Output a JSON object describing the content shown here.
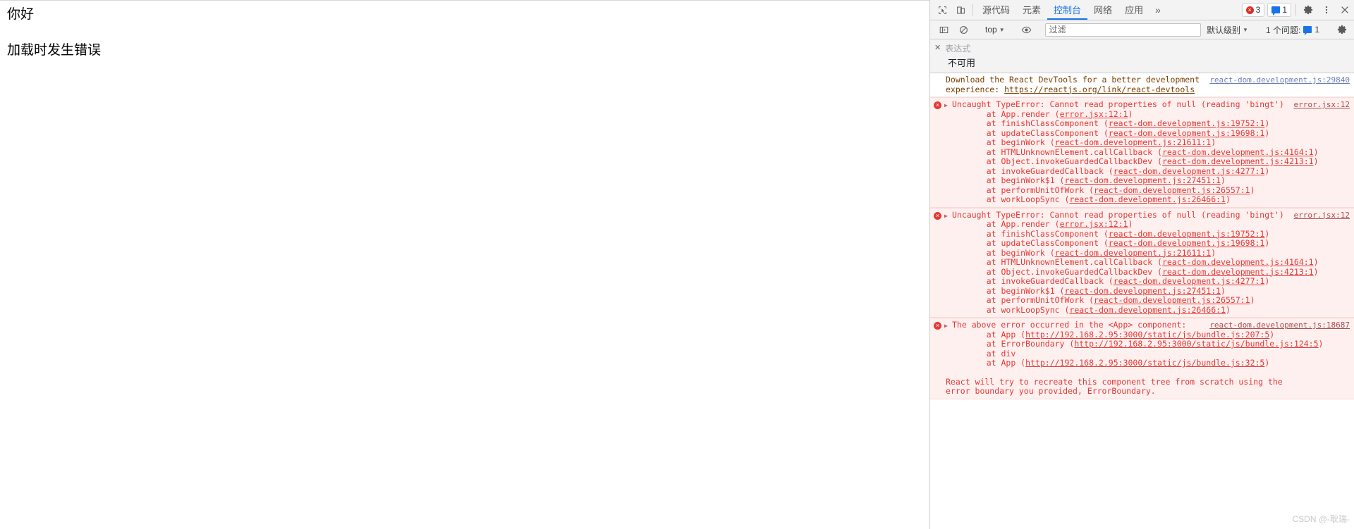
{
  "page": {
    "lines": [
      "你好",
      "加载时发生错误"
    ]
  },
  "devtools": {
    "tabbar": {
      "inspect_icon": "inspect-cursor-icon",
      "device_icon": "device-toolbar-icon",
      "tabs": [
        {
          "label": "源代码",
          "active": false
        },
        {
          "label": "元素",
          "active": false
        },
        {
          "label": "控制台",
          "active": true
        },
        {
          "label": "网络",
          "active": false
        },
        {
          "label": "应用",
          "active": false
        }
      ],
      "more_label": "»",
      "error_count": "3",
      "message_count": "1",
      "settings_icon": "gear-icon",
      "kebab_icon": "more-vertical-icon",
      "close_icon": "close-icon"
    },
    "filterbar": {
      "sidebar_icon": "console-sidebar-icon",
      "clear_icon": "clear-console-icon",
      "context": "top",
      "eye_icon": "live-expression-eye-icon",
      "filter_placeholder": "过滤",
      "filter_value": "",
      "level": "默认级别",
      "issues_label": "1 个问题:",
      "issues_count": "1",
      "settings_icon": "console-settings-gear-icon"
    },
    "live_expression": {
      "close_icon": "close-icon",
      "placeholder": "表达式",
      "value": "不可用"
    },
    "messages": [
      {
        "type": "info",
        "source": "react-dom.development.js:29840",
        "headline_parts": [
          {
            "text": "Download the React DevTools for a better development experience: ",
            "link": false
          },
          {
            "text": "https://reactjs.org/link/react-devtools",
            "link": true
          }
        ],
        "stack": []
      },
      {
        "type": "error",
        "source": "error.jsx:12",
        "headline_parts": [
          {
            "text": "Uncaught TypeError: Cannot read properties of null (reading 'bingt')",
            "link": false
          }
        ],
        "stack": [
          {
            "fn": "    at App.render (",
            "loc": "error.jsx:12:1",
            "close": ")"
          },
          {
            "fn": "    at finishClassComponent (",
            "loc": "react-dom.development.js:19752:1",
            "close": ")"
          },
          {
            "fn": "    at updateClassComponent (",
            "loc": "react-dom.development.js:19698:1",
            "close": ")"
          },
          {
            "fn": "    at beginWork (",
            "loc": "react-dom.development.js:21611:1",
            "close": ")"
          },
          {
            "fn": "    at HTMLUnknownElement.callCallback (",
            "loc": "react-dom.development.js:4164:1",
            "close": ")"
          },
          {
            "fn": "    at Object.invokeGuardedCallbackDev (",
            "loc": "react-dom.development.js:4213:1",
            "close": ")"
          },
          {
            "fn": "    at invokeGuardedCallback (",
            "loc": "react-dom.development.js:4277:1",
            "close": ")"
          },
          {
            "fn": "    at beginWork$1 (",
            "loc": "react-dom.development.js:27451:1",
            "close": ")"
          },
          {
            "fn": "    at performUnitOfWork (",
            "loc": "react-dom.development.js:26557:1",
            "close": ")"
          },
          {
            "fn": "    at workLoopSync (",
            "loc": "react-dom.development.js:26466:1",
            "close": ")"
          }
        ]
      },
      {
        "type": "error",
        "source": "error.jsx:12",
        "headline_parts": [
          {
            "text": "Uncaught TypeError: Cannot read properties of null (reading 'bingt')",
            "link": false
          }
        ],
        "stack": [
          {
            "fn": "    at App.render (",
            "loc": "error.jsx:12:1",
            "close": ")"
          },
          {
            "fn": "    at finishClassComponent (",
            "loc": "react-dom.development.js:19752:1",
            "close": ")"
          },
          {
            "fn": "    at updateClassComponent (",
            "loc": "react-dom.development.js:19698:1",
            "close": ")"
          },
          {
            "fn": "    at beginWork (",
            "loc": "react-dom.development.js:21611:1",
            "close": ")"
          },
          {
            "fn": "    at HTMLUnknownElement.callCallback (",
            "loc": "react-dom.development.js:4164:1",
            "close": ")"
          },
          {
            "fn": "    at Object.invokeGuardedCallbackDev (",
            "loc": "react-dom.development.js:4213:1",
            "close": ")"
          },
          {
            "fn": "    at invokeGuardedCallback (",
            "loc": "react-dom.development.js:4277:1",
            "close": ")"
          },
          {
            "fn": "    at beginWork$1 (",
            "loc": "react-dom.development.js:27451:1",
            "close": ")"
          },
          {
            "fn": "    at performUnitOfWork (",
            "loc": "react-dom.development.js:26557:1",
            "close": ")"
          },
          {
            "fn": "    at workLoopSync (",
            "loc": "react-dom.development.js:26466:1",
            "close": ")"
          }
        ]
      },
      {
        "type": "error",
        "source": "react-dom.development.js:18687",
        "headline_parts": [
          {
            "text": "The above error occurred in the <App> component:",
            "link": false
          }
        ],
        "stack": [
          {
            "fn": "    at App (",
            "loc": "http://192.168.2.95:3000/static/js/bundle.js:207:5",
            "close": ")"
          },
          {
            "fn": "    at ErrorBoundary (",
            "loc": "http://192.168.2.95:3000/static/js/bundle.js:124:5",
            "close": ")"
          },
          {
            "fn": "    at div",
            "loc": "",
            "close": ""
          },
          {
            "fn": "    at App (",
            "loc": "http://192.168.2.95:3000/static/js/bundle.js:32:5",
            "close": ")"
          }
        ],
        "tail": "React will try to recreate this component tree from scratch using the\nerror boundary you provided, ErrorBoundary."
      }
    ]
  },
  "watermark": "CSDN @-耿瑞-"
}
